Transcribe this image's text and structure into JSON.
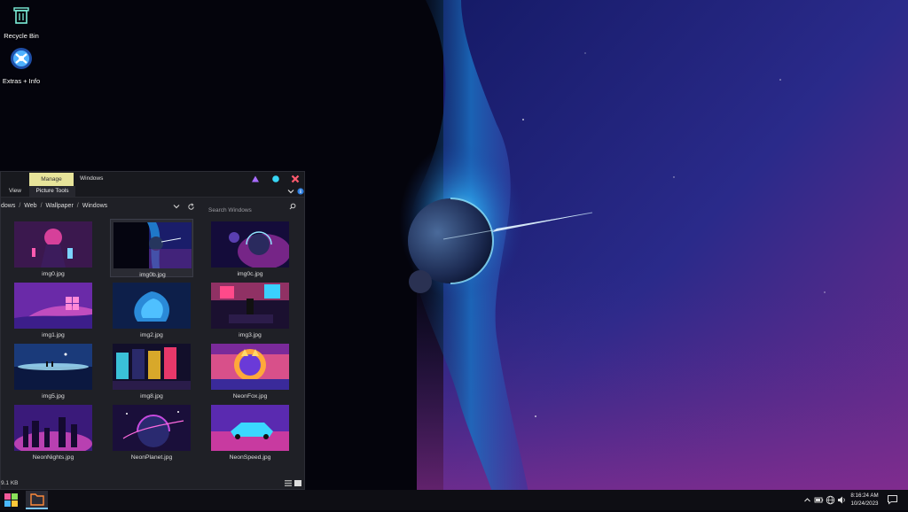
{
  "desktop": {
    "icons": [
      {
        "label": "Recycle Bin",
        "icon": "recycle-bin-icon"
      },
      {
        "label": "Extras + Info",
        "icon": "extras-info-icon"
      }
    ]
  },
  "explorer": {
    "title": "Windows",
    "manage_tab": "Manage",
    "ribbon_tabs": [
      "View",
      "Picture Tools"
    ],
    "path": [
      "dows",
      "Web",
      "Wallpaper",
      "Windows"
    ],
    "search_placeholder": "Search Windows",
    "files": [
      {
        "name": "img0.jpg",
        "selected": false
      },
      {
        "name": "img0b.jpg",
        "selected": true
      },
      {
        "name": "img0c.jpg",
        "selected": false
      },
      {
        "name": "img1.jpg",
        "selected": false
      },
      {
        "name": "img2.jpg",
        "selected": false
      },
      {
        "name": "img3.jpg",
        "selected": false
      },
      {
        "name": "img5.jpg",
        "selected": false
      },
      {
        "name": "img8.jpg",
        "selected": false
      },
      {
        "name": "NeonFox.jpg",
        "selected": false
      },
      {
        "name": "NeonNights.jpg",
        "selected": false
      },
      {
        "name": "NeonPlanet.jpg",
        "selected": false
      },
      {
        "name": "NeonSpeed.jpg",
        "selected": false
      }
    ],
    "status": "9.1 KB",
    "colors": {
      "manage_accent": "#e7e49a",
      "close": "#ff5a6e",
      "maximize": "#38d6f5",
      "minimize": "#a86cff"
    }
  },
  "taskbar": {
    "time": "8:16:24 AM",
    "date": "10/24/2023",
    "tray_icons": [
      "chevron-up-icon",
      "battery-icon",
      "network-icon",
      "volume-icon",
      "notification-icon"
    ]
  }
}
